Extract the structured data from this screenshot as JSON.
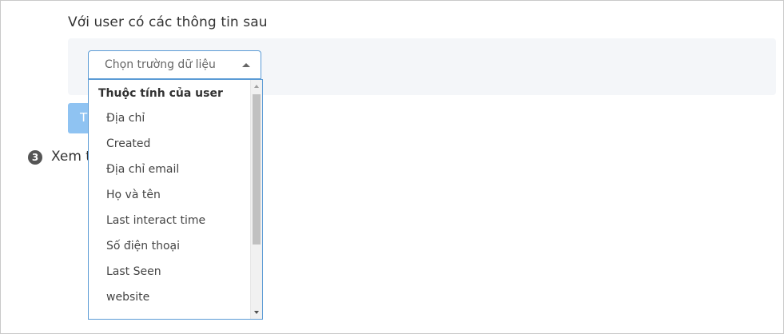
{
  "condition": {
    "title": "Với user có các thông tin sau"
  },
  "field_select": {
    "placeholder": "Chọn trường dữ liệu",
    "expanded": true
  },
  "button": {
    "label_fragment": "T"
  },
  "step": {
    "number": "3",
    "label_fragment": "Xem t"
  },
  "dropdown": {
    "group_label": "Thuộc tính của user",
    "options": [
      "Địa chỉ",
      "Created",
      "Địa chỉ email",
      "Họ và tên",
      "Last interact time",
      "Số điện thoại",
      "Last Seen",
      "website"
    ]
  },
  "colors": {
    "accent_border": "#5b9bd5",
    "button_bg": "#8fc3f2",
    "panel_bg": "#f4f6f9"
  }
}
